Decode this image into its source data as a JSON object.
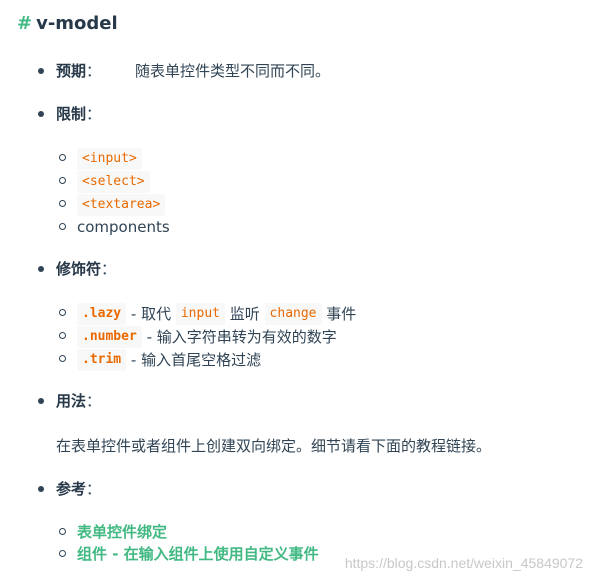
{
  "heading": {
    "hash": "#",
    "title": "v-model"
  },
  "expectation": {
    "label": "预期",
    "colon": "：",
    "text": "随表单控件类型不同而不同。"
  },
  "restriction": {
    "label": "限制",
    "colon": "：",
    "items": [
      "<input>",
      "<select>",
      "<textarea>",
      "components"
    ]
  },
  "modifiers": {
    "label": "修饰符",
    "colon": "：",
    "items": [
      {
        "code": ".lazy",
        "text1": " - 取代 ",
        "code2": "input",
        "text2": " 监听 ",
        "code3": "change",
        "text3": " 事件"
      },
      {
        "code": ".number",
        "text1": " - 输入字符串转为有效的数字"
      },
      {
        "code": ".trim",
        "text1": " - 输入首尾空格过滤"
      }
    ]
  },
  "usage": {
    "label": "用法",
    "colon": "：",
    "text": "在表单控件或者组件上创建双向绑定。细节请看下面的教程链接。"
  },
  "reference": {
    "label": "参考",
    "colon": "：",
    "links": [
      "表单控件绑定",
      "组件 - 在输入组件上使用自定义事件"
    ]
  },
  "watermark": "https://blog.csdn.net/weixin_45849072",
  "colors": {
    "accent": "#42b983",
    "code": "#e96900",
    "text": "#304455"
  }
}
